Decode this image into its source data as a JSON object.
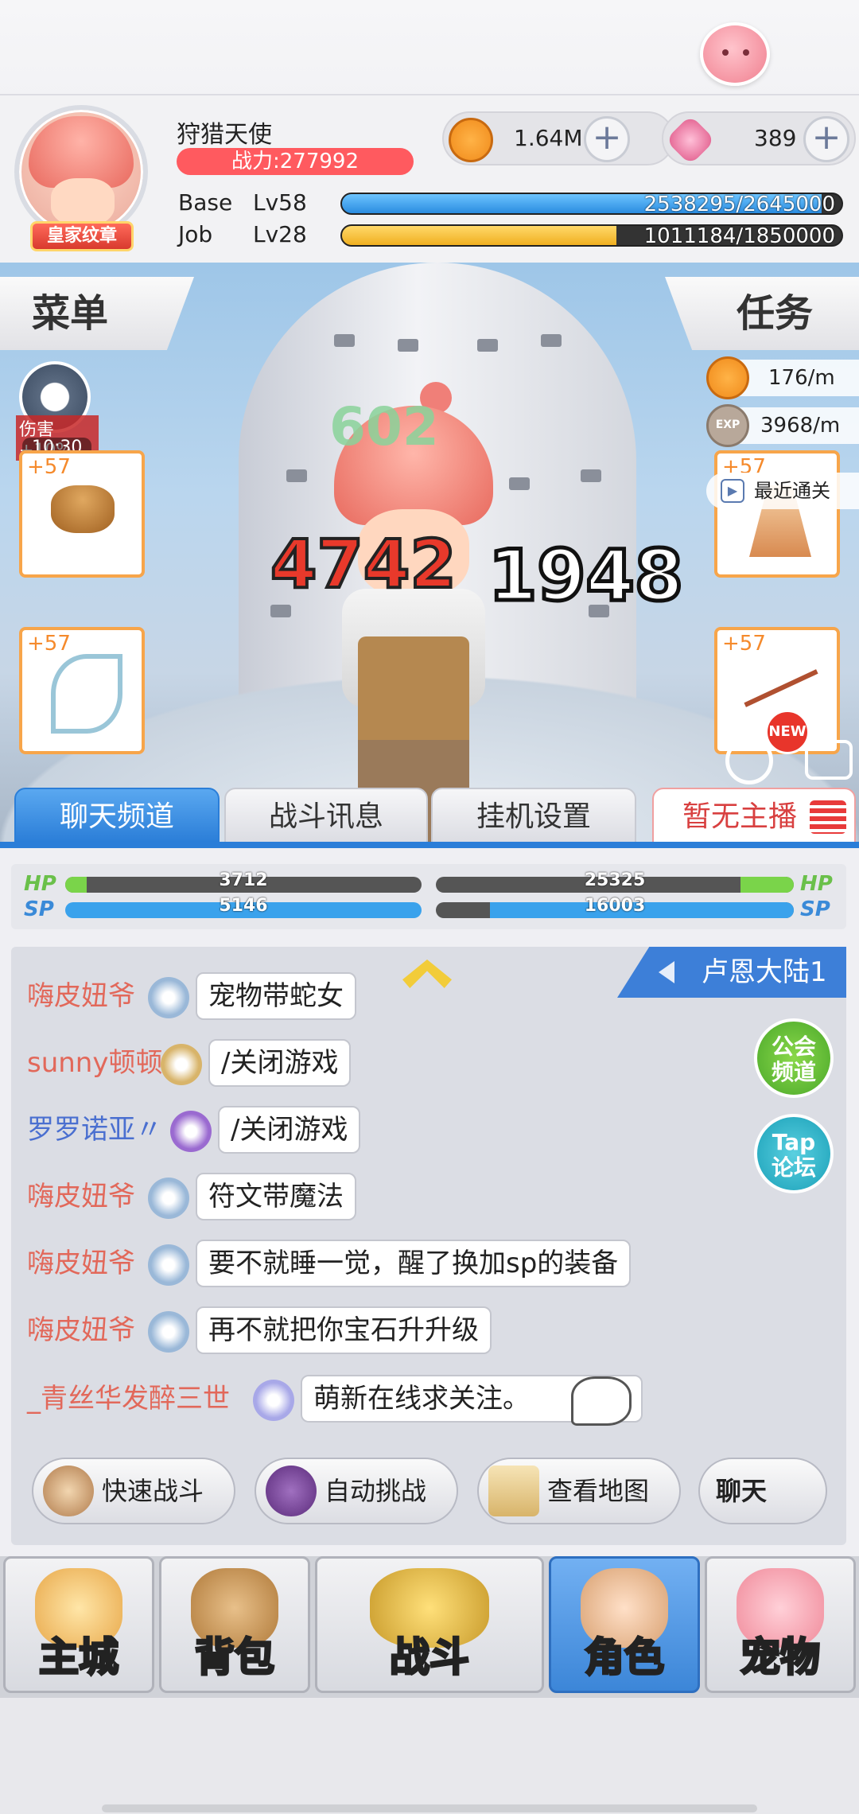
{
  "header": {
    "player_name": "狩猎天使",
    "power": "战力:277992",
    "badge": "皇家纹章",
    "gold": "1.64M",
    "gems": "389",
    "base_label": "Base",
    "base_level": "Lv58",
    "base_exp": "2538295/2645000",
    "base_progress": 0.96,
    "job_label": "Job",
    "job_level": "Lv28",
    "job_exp": "1011184/1850000",
    "job_progress": 0.55
  },
  "scene": {
    "menu_label": "菜单",
    "quest_label": "任务",
    "buff_text": "伤害+10%",
    "buff_timer": "10:30",
    "gold_rate": "176/m",
    "exp_rate": "3968/m",
    "exp_icon_text": "EXP",
    "recent_clear": "最近通关",
    "equip_plus": "+57",
    "new_badge": "NEW",
    "damage_red": "4742",
    "damage_white": "1948",
    "damage_green": "602"
  },
  "tabs": [
    {
      "label": "聊天频道",
      "active": true
    },
    {
      "label": "战斗讯息",
      "active": false
    },
    {
      "label": "挂机设置",
      "active": false
    }
  ],
  "broadcast": "暂无主播",
  "bars": {
    "hp_label": "HP",
    "sp_label": "SP",
    "my_hp": "3712",
    "my_hp_progress": 0.06,
    "my_sp": "5146",
    "my_sp_progress": 1.0,
    "enemy_hp": "25325",
    "enemy_hp_progress": 0.15,
    "enemy_sp": "16003",
    "enemy_sp_progress": 0.85
  },
  "chat": {
    "region": "卢恩大陆1",
    "guild_btn": "公会\n频道",
    "tap_btn": "Tap\n论坛",
    "messages": [
      {
        "name": "嗨皮妞爷",
        "text": "宠物带蛇女",
        "color": "#e2685a"
      },
      {
        "name": "sunny顿顿",
        "text": "/关闭游戏",
        "color": "#e2685a"
      },
      {
        "name": "罗罗诺亚〃",
        "text": "/关闭游戏",
        "color": "#4a6fd0"
      },
      {
        "name": "嗨皮妞爷",
        "text": "符文带魔法",
        "color": "#e2685a"
      },
      {
        "name": "嗨皮妞爷",
        "text": "要不就睡一觉，醒了换加sp的装备",
        "color": "#e2685a"
      },
      {
        "name": "嗨皮妞爷",
        "text": "再不就把你宝石升升级",
        "color": "#e2685a"
      },
      {
        "name": "_青丝华发醉三世",
        "text": "萌新在线求关注。",
        "color": "#e2685a"
      }
    ]
  },
  "quick": {
    "fast_battle": "快速战斗",
    "auto_challenge": "自动挑战",
    "view_map": "查看地图",
    "chat": "聊天"
  },
  "nav": [
    {
      "label": "主城",
      "active": false
    },
    {
      "label": "背包",
      "active": false
    },
    {
      "label": "战斗",
      "active": false
    },
    {
      "label": "角色",
      "active": true
    },
    {
      "label": "宠物",
      "active": false
    }
  ]
}
